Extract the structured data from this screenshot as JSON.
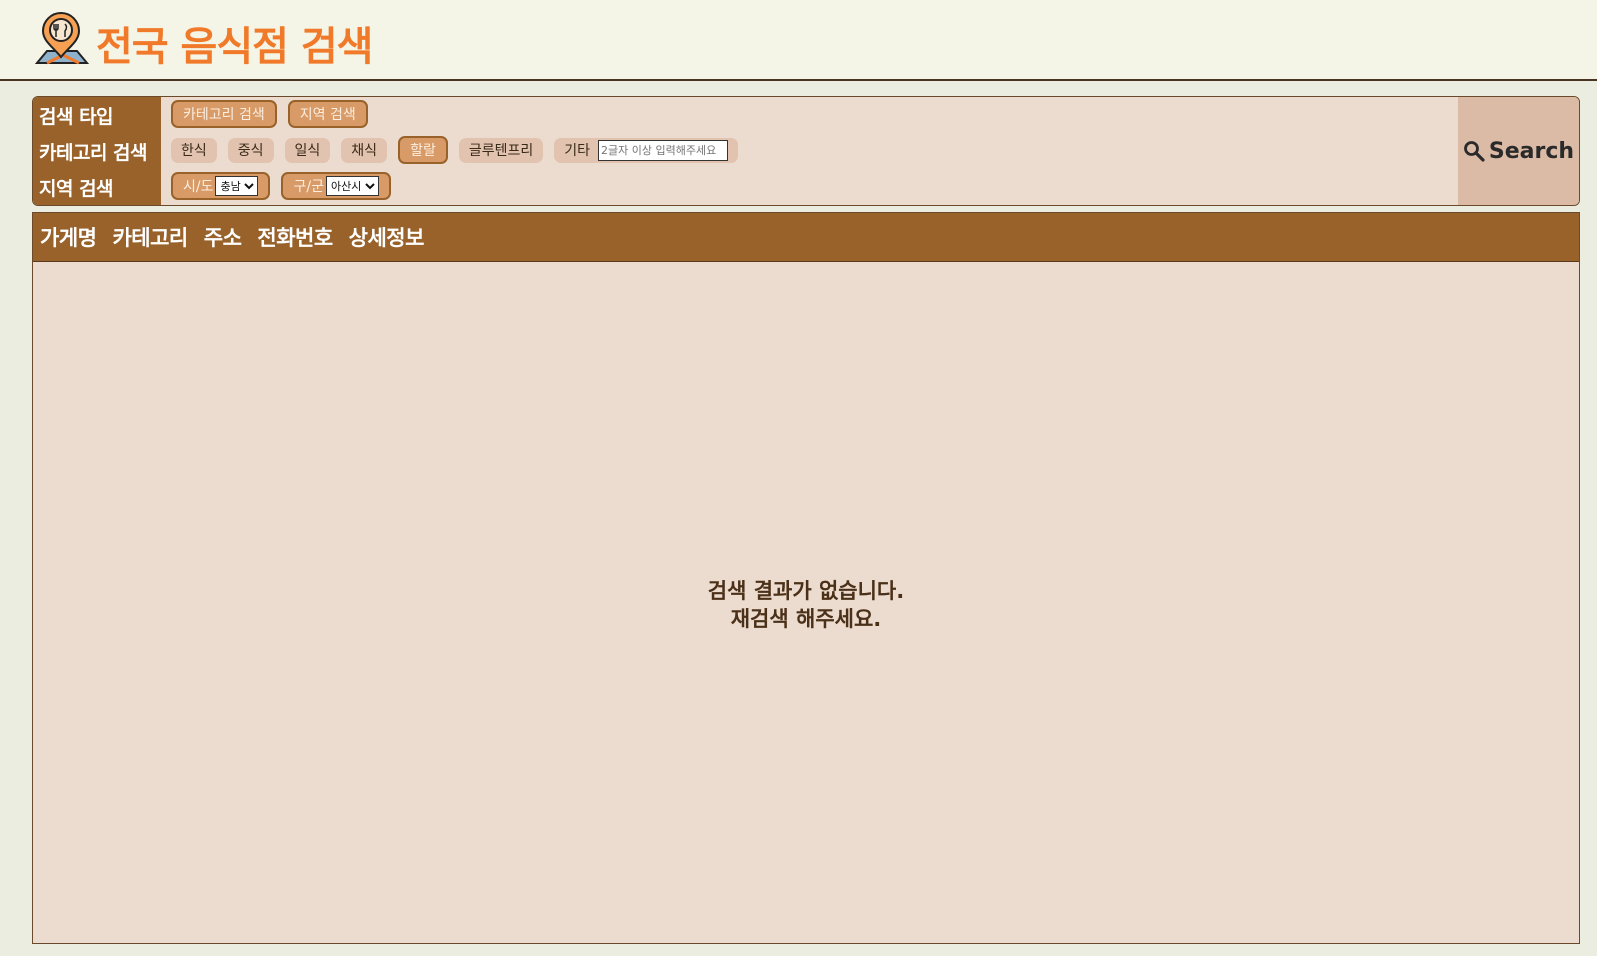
{
  "header": {
    "title": "전국 음식점 검색",
    "logo_icon": "map-pin-food-icon"
  },
  "search": {
    "rows": {
      "type_label": "검색 타입",
      "category_label": "카테고리 검색",
      "region_label": "지역 검색"
    },
    "type_options": [
      "카테고리 검색",
      "지역 검색"
    ],
    "categories": [
      "한식",
      "중식",
      "일식",
      "채식",
      "할랄",
      "글루텐프리"
    ],
    "selected_category": "할랄",
    "other": {
      "label": "기타",
      "placeholder": "2글자 이상 입력해주세요"
    },
    "sido": {
      "label": "시/도",
      "value": "충남"
    },
    "gugun": {
      "label": "구/군",
      "value": "아산시"
    },
    "button_label": "Search",
    "button_icon": "search-icon"
  },
  "results": {
    "columns": [
      "가게명",
      "카테고리",
      "주소",
      "전화번호",
      "상세정보"
    ],
    "empty_line1": "검색 결과가 없습니다.",
    "empty_line2": "재검색 해주세요."
  },
  "colors": {
    "accent": "#f07a2a",
    "brown": "#98622a",
    "panel": "#ecdccf"
  }
}
